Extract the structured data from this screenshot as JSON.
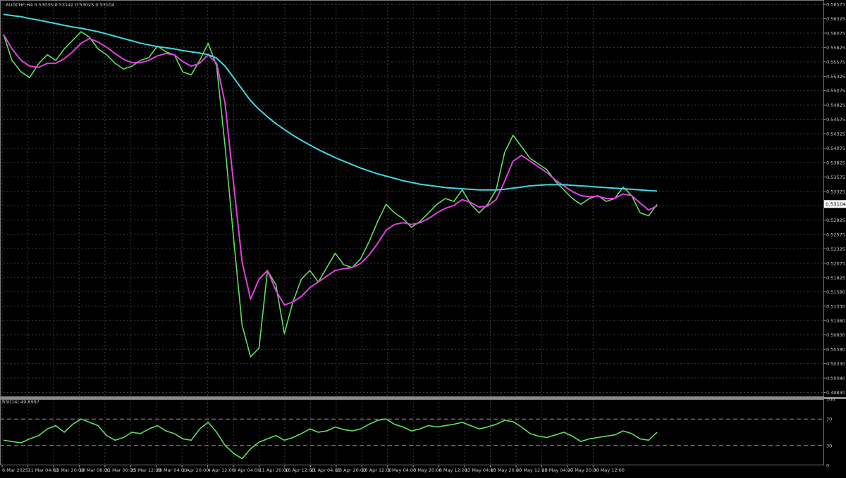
{
  "chart_data": [
    {
      "type": "line",
      "panel": "main",
      "header": "AUDCHF,H4  0.53035 0.53142 0.53025 0.53104",
      "symbol": "AUDCHF",
      "timeframe": "H4",
      "ohlc": {
        "open": 0.53035,
        "high": 0.53142,
        "low": 0.53025,
        "close": 0.53104
      },
      "last_price_label": "0.53104",
      "y_ticks": [
        "0.56575",
        "0.56325",
        "0.56075",
        "0.55825",
        "0.55575",
        "0.55325",
        "0.55075",
        "0.54825",
        "0.54575",
        "0.54325",
        "0.54075",
        "0.53825",
        "0.53575",
        "0.53325",
        "0.53075",
        "0.52825",
        "0.52575",
        "0.52325",
        "0.52075",
        "0.51825",
        "0.51580",
        "0.51330",
        "0.51080",
        "0.50830",
        "0.50580",
        "0.50330",
        "0.50080",
        "0.49830"
      ],
      "ylim": [
        0.4975,
        0.5665
      ],
      "x_ticks": [
        "6 Mar 2025",
        "11 Mar 04:00",
        "13 Mar 20:00",
        "18 Mar 08:00",
        "21 Mar 00:00",
        "25 Mar 12:00",
        "28 Mar 04:00",
        "1 Apr 20:00",
        "4 Apr 12:00",
        "9 Apr 04:00",
        "11 Apr 20:00",
        "16 Apr 12:00",
        "21 Apr 04:00",
        "23 Apr 20:00",
        "28 Apr 12:00",
        "1 May 04:00",
        "5 May 20:00",
        "8 May 12:00",
        "13 May 04:00",
        "15 May 20:00",
        "20 May 12:00",
        "23 May 04:00",
        "27 May 20:00",
        "30 May 12:00"
      ],
      "grid": true,
      "colors": {
        "price": "#5fe05f",
        "ma_fast": "#e040e0",
        "ma_slow": "#40d8e0",
        "grid": "#3c3c3c",
        "text": "#c8c8c8",
        "background": "#000000"
      },
      "x": [
        0,
        12,
        25,
        37,
        50,
        62,
        74,
        86,
        98,
        110,
        122,
        134,
        146,
        158,
        170,
        182,
        194,
        206,
        218,
        230,
        242,
        254,
        266,
        278,
        290,
        302,
        314,
        326,
        338,
        350,
        362,
        374,
        386,
        398,
        410,
        422,
        434,
        446,
        458,
        470,
        482,
        494,
        506,
        518,
        530,
        542,
        554,
        566,
        578,
        590,
        602,
        614,
        626,
        638,
        650,
        662,
        674,
        686,
        698,
        710,
        722,
        734,
        746,
        758,
        770,
        782,
        794,
        806,
        818,
        830,
        842,
        854,
        866,
        878,
        890,
        902,
        914,
        926
      ],
      "series": [
        {
          "key": "price",
          "values": [
            0.5605,
            0.556,
            0.554,
            0.553,
            0.5555,
            0.557,
            0.556,
            0.558,
            0.5595,
            0.561,
            0.56,
            0.558,
            0.557,
            0.5555,
            0.5545,
            0.555,
            0.556,
            0.5565,
            0.5585,
            0.5575,
            0.557,
            0.554,
            0.5535,
            0.556,
            0.559,
            0.555,
            0.541,
            0.525,
            0.51,
            0.5045,
            0.506,
            0.5195,
            0.517,
            0.5085,
            0.514,
            0.518,
            0.5195,
            0.5175,
            0.52,
            0.5225,
            0.5205,
            0.52,
            0.5215,
            0.5245,
            0.528,
            0.531,
            0.5295,
            0.5285,
            0.527,
            0.528,
            0.5295,
            0.531,
            0.532,
            0.5315,
            0.5335,
            0.531,
            0.5295,
            0.531,
            0.5335,
            0.54,
            0.543,
            0.541,
            0.539,
            0.538,
            0.537,
            0.535,
            0.5335,
            0.532,
            0.531,
            0.532,
            0.5325,
            0.5315,
            0.532,
            0.534,
            0.5325,
            0.5295,
            0.529,
            0.531
          ]
        },
        {
          "key": "ma_fast",
          "values": [
            0.5605,
            0.558,
            0.556,
            0.555,
            0.5548,
            0.5555,
            0.5555,
            0.5563,
            0.5575,
            0.559,
            0.5598,
            0.5592,
            0.5583,
            0.5572,
            0.5562,
            0.5556,
            0.5556,
            0.556,
            0.5568,
            0.5572,
            0.557,
            0.5558,
            0.555,
            0.5555,
            0.557,
            0.5555,
            0.5485,
            0.5345,
            0.521,
            0.5145,
            0.518,
            0.5195,
            0.516,
            0.5135,
            0.514,
            0.515,
            0.5165,
            0.5175,
            0.5185,
            0.5195,
            0.5198,
            0.52,
            0.5207,
            0.5222,
            0.5242,
            0.5265,
            0.5275,
            0.5278,
            0.5275,
            0.5278,
            0.5285,
            0.5295,
            0.5303,
            0.5308,
            0.5318,
            0.5313,
            0.5305,
            0.5307,
            0.5318,
            0.535,
            0.5385,
            0.5395,
            0.5385,
            0.5375,
            0.5365,
            0.5352,
            0.5342,
            0.5332,
            0.5325,
            0.5323,
            0.5324,
            0.532,
            0.532,
            0.5328,
            0.5325,
            0.5312,
            0.53,
            0.5307
          ]
        },
        {
          "key": "ma_slow",
          "values": [
            0.564,
            0.5638,
            0.5636,
            0.5633,
            0.563,
            0.5627,
            0.5624,
            0.5621,
            0.5618,
            0.5616,
            0.5613,
            0.561,
            0.5606,
            0.5602,
            0.5598,
            0.5594,
            0.559,
            0.5587,
            0.5584,
            0.5582,
            0.558,
            0.5577,
            0.5575,
            0.5573,
            0.557,
            0.5564,
            0.555,
            0.553,
            0.551,
            0.549,
            0.5475,
            0.5462,
            0.545,
            0.544,
            0.543,
            0.5421,
            0.5413,
            0.5405,
            0.5398,
            0.5391,
            0.5385,
            0.5379,
            0.5373,
            0.5368,
            0.5363,
            0.5359,
            0.5355,
            0.5351,
            0.5348,
            0.5345,
            0.5343,
            0.5341,
            0.5339,
            0.5338,
            0.5337,
            0.5336,
            0.5335,
            0.5335,
            0.5335,
            0.5336,
            0.5338,
            0.534,
            0.5342,
            0.5343,
            0.5344,
            0.5344,
            0.5344,
            0.5343,
            0.5342,
            0.5341,
            0.534,
            0.5339,
            0.5338,
            0.5337,
            0.5336,
            0.5335,
            0.5334,
            0.5333
          ]
        }
      ]
    },
    {
      "type": "line",
      "panel": "rsi",
      "header": "RSI(14) 49.8997",
      "y_ticks": [
        "100",
        "70",
        "30",
        "0"
      ],
      "ylim": [
        0,
        100
      ],
      "levels": [
        70,
        30
      ],
      "x": [
        0,
        12,
        25,
        37,
        50,
        62,
        74,
        86,
        98,
        110,
        122,
        134,
        146,
        158,
        170,
        182,
        194,
        206,
        218,
        230,
        242,
        254,
        266,
        278,
        290,
        302,
        314,
        326,
        338,
        350,
        362,
        374,
        386,
        398,
        410,
        422,
        434,
        446,
        458,
        470,
        482,
        494,
        506,
        518,
        530,
        542,
        554,
        566,
        578,
        590,
        602,
        614,
        626,
        638,
        650,
        662,
        674,
        686,
        698,
        710,
        722,
        734,
        746,
        758,
        770,
        782,
        794,
        806,
        818,
        830,
        842,
        854,
        866,
        878,
        890,
        902,
        914,
        926
      ],
      "series": [
        {
          "key": "rsi",
          "values": [
            38,
            36,
            34,
            40,
            45,
            55,
            60,
            50,
            62,
            70,
            65,
            60,
            45,
            38,
            42,
            50,
            48,
            55,
            60,
            52,
            48,
            40,
            38,
            55,
            65,
            50,
            30,
            18,
            10,
            25,
            35,
            40,
            45,
            38,
            42,
            48,
            55,
            50,
            52,
            58,
            54,
            52,
            55,
            62,
            68,
            70,
            62,
            58,
            52,
            55,
            60,
            58,
            60,
            62,
            65,
            60,
            55,
            58,
            62,
            68,
            66,
            58,
            48,
            44,
            42,
            46,
            50,
            44,
            36,
            40,
            42,
            44,
            46,
            52,
            48,
            40,
            38,
            50
          ]
        }
      ]
    }
  ]
}
